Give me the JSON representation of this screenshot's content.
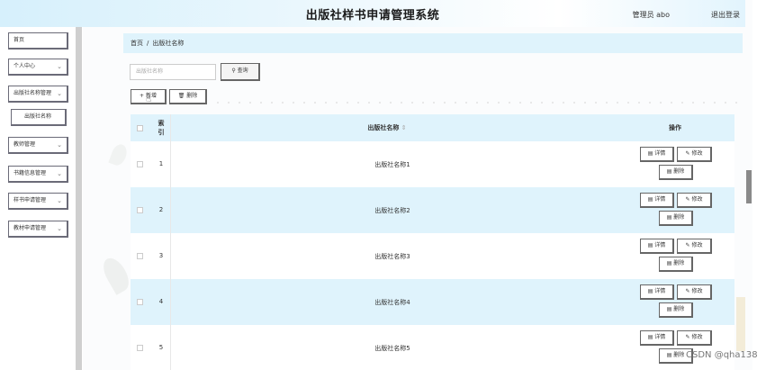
{
  "header": {
    "title": "出版社样书申请管理系统",
    "user": "管理员 abo",
    "logout": "退出登录"
  },
  "sidebar": {
    "items": [
      {
        "label": "首页",
        "chevron": false
      },
      {
        "label": "个人中心",
        "chevron": true
      },
      {
        "label": "出版社名称管理",
        "chevron": true
      },
      {
        "label": "出版社名称",
        "chevron": false,
        "sub": true
      },
      {
        "label": "教师管理",
        "chevron": true
      },
      {
        "label": "书籍信息管理",
        "chevron": true
      },
      {
        "label": "样书申请管理",
        "chevron": true
      },
      {
        "label": "教材申请管理",
        "chevron": true
      }
    ]
  },
  "breadcrumb": {
    "home": "首页",
    "separator": "/",
    "current": "出版社名称"
  },
  "search": {
    "placeholder": "出版社名称",
    "button": "查询",
    "button_icon": "search-icon"
  },
  "toolbar": {
    "add": "新增",
    "delete": "删除"
  },
  "table": {
    "columns": {
      "index_line1": "索",
      "index_line2": "引",
      "name": "出版社名称",
      "name_sort": "⇕",
      "ops": "操作"
    },
    "rows": [
      {
        "index": "1",
        "name": "出版社名称1"
      },
      {
        "index": "2",
        "name": "出版社名称2"
      },
      {
        "index": "3",
        "name": "出版社名称3"
      },
      {
        "index": "4",
        "name": "出版社名称4"
      },
      {
        "index": "5",
        "name": "出版社名称5"
      }
    ],
    "actions": {
      "detail": "详情",
      "edit": "修改",
      "delete": "删除"
    }
  },
  "watermark": "CSDN @qha138",
  "colors": {
    "accent_row": "#dff3fc",
    "header_gradient": "#d6f0fc"
  }
}
